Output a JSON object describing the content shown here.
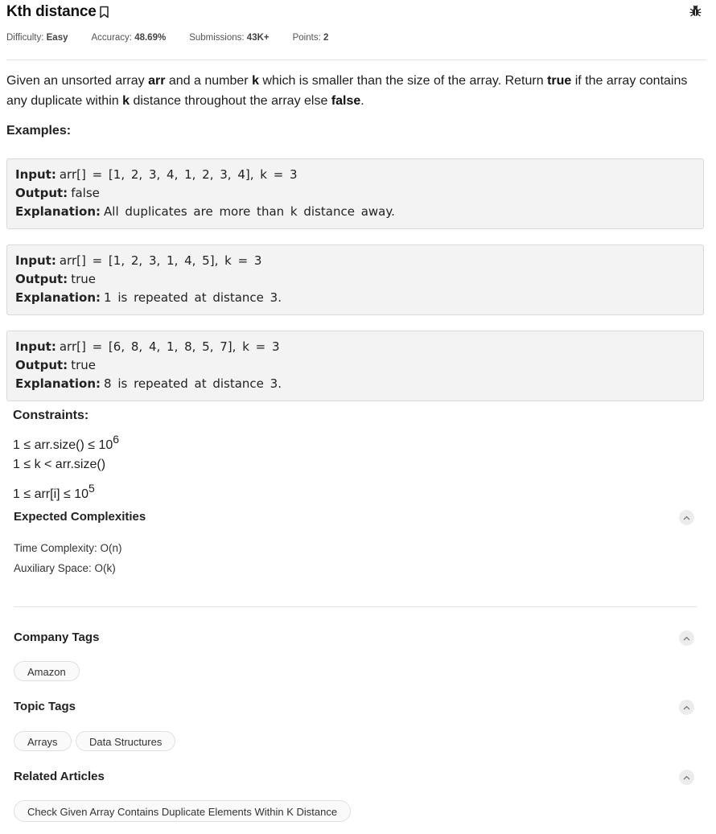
{
  "problem": {
    "title": "Kth distance",
    "meta": [
      {
        "label": "Difficulty: ",
        "value": "Easy"
      },
      {
        "label": "Accuracy: ",
        "value": "48.69%"
      },
      {
        "label": "Submissions: ",
        "value": "43K+"
      },
      {
        "label": "Points: ",
        "value": "2"
      }
    ],
    "description": {
      "t1": "Given an unsorted array ",
      "b1": "arr",
      "t2": " and a number ",
      "b2": "k",
      "t3": " which is smaller than the size of the array. Return ",
      "b3": "true",
      "t4": " if the array contains any duplicate within ",
      "b4": "k",
      "t5": " distance throughout the array else ",
      "b5": "false",
      "t6": "."
    }
  },
  "examples_label": "Examples:",
  "examples": [
    {
      "input_label": "Input:",
      "input": "arr[] = [1, 2, 3, 4, 1, 2, 3, 4], k = 3",
      "output_label": "Output:",
      "output": "false",
      "explanation_label": "Explanation:",
      "explanation": "All duplicates are more than k distance away."
    },
    {
      "input_label": "Input:",
      "input": "arr[] = [1, 2, 3, 1, 4, 5], k = 3",
      "output_label": "Output:",
      "output": "true",
      "explanation_label": "Explanation:",
      "explanation": "1 is repeated at distance 3."
    },
    {
      "input_label": "Input:",
      "input": "arr[] = [6, 8, 4, 1, 8, 5, 7], k = 3",
      "output_label": "Output:",
      "output": "true",
      "explanation_label": "Explanation:",
      "explanation": "8 is repeated at distance 3."
    }
  ],
  "constraints": {
    "label": "Constraints:",
    "items": [
      {
        "text": "1 ≤ arr.size() ≤ 10",
        "sup": "6"
      },
      {
        "text": "1 ≤ k < arr.size()",
        "sup": ""
      },
      {
        "text": "1 ≤ arr[i] ≤ 10",
        "sup": "5"
      }
    ]
  },
  "complexities": {
    "title": "Expected Complexities",
    "time": "Time Complexity: O(n)",
    "space": "Auxiliary Space: O(k)"
  },
  "company_tags": {
    "title": "Company Tags",
    "tags": [
      "Amazon"
    ]
  },
  "topic_tags": {
    "title": "Topic Tags",
    "tags": [
      "Arrays",
      "Data Structures"
    ]
  },
  "related_articles": {
    "title": "Related Articles",
    "items": [
      "Check Given Array Contains Duplicate Elements Within K Distance"
    ]
  },
  "icons": {
    "bookmark": "bookmark-icon",
    "bug": "bug-icon",
    "chevron": "chevron-up-icon"
  }
}
